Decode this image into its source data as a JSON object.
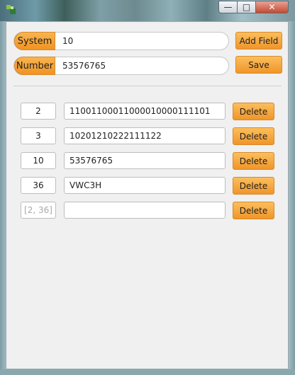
{
  "window": {
    "controls": {
      "minimize_icon": "minimize-icon",
      "maximize_icon": "maximize-icon",
      "close_icon": "close-icon"
    }
  },
  "header": {
    "system_label": "System",
    "system_value": "10",
    "number_label": "Number",
    "number_value": "53576765",
    "add_field_label": "Add Field",
    "save_label": "Save"
  },
  "rows": [
    {
      "base": "2",
      "value": "11001100011000010000111101",
      "delete_label": "Delete"
    },
    {
      "base": "3",
      "value": "10201210222111122",
      "delete_label": "Delete"
    },
    {
      "base": "10",
      "value": "53576765",
      "delete_label": "Delete"
    },
    {
      "base": "36",
      "value": "VWC3H",
      "delete_label": "Delete"
    },
    {
      "base_placeholder": "[2, 36]",
      "value": "",
      "delete_label": "Delete"
    }
  ]
}
